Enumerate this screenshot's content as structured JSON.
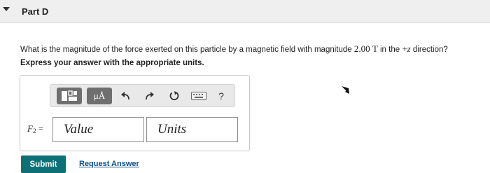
{
  "part": {
    "title": "Part D"
  },
  "question": {
    "text_before": "What is the magnitude of the force exerted on this particle by a magnetic field with magnitude ",
    "field_value": "2.00",
    "field_unit": "T",
    "text_middle": " in the ",
    "direction_sign": "+",
    "direction_axis": "z",
    "text_after": " direction?"
  },
  "instruction": "Express your answer with the appropriate units.",
  "toolbar": {
    "templates_icon": "grid-template-icon",
    "units_label": "μÅ",
    "undo_icon": "undo-icon",
    "redo_icon": "redo-icon",
    "reset_icon": "reset-icon",
    "keyboard_icon": "keyboard-icon",
    "help_label": "?"
  },
  "answer": {
    "label_symbol": "F",
    "label_subscript": "2",
    "label_equals": " =",
    "value_placeholder": "Value",
    "units_placeholder": "Units"
  },
  "actions": {
    "submit_label": "Submit",
    "request_label": "Request Answer"
  },
  "colors": {
    "submit_bg": "#0d7077",
    "link": "#0b4f87",
    "header_bg": "#efefef"
  }
}
